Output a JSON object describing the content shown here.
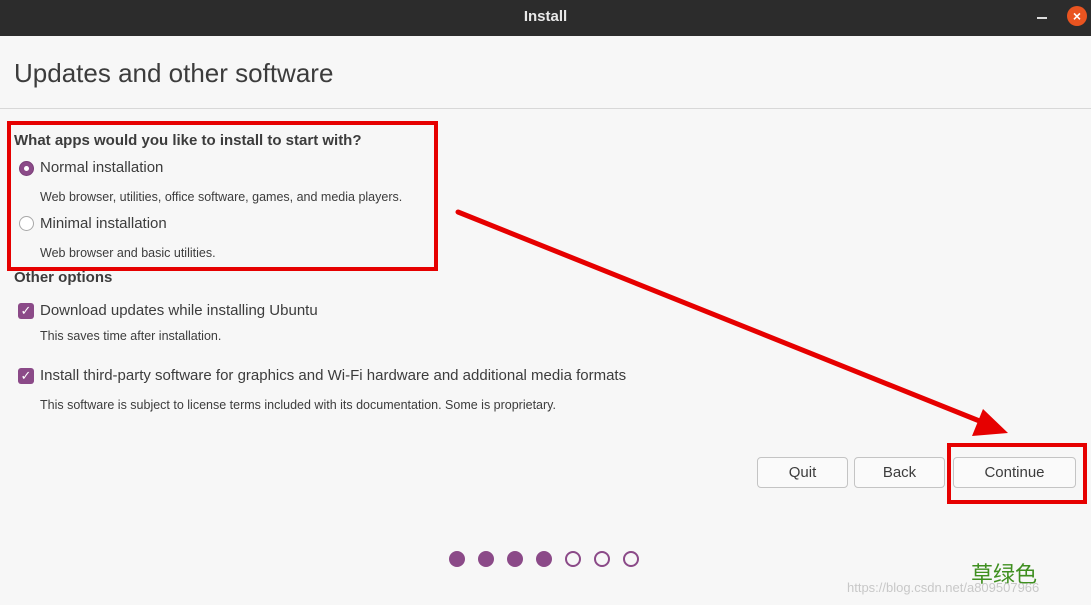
{
  "window": {
    "title": "Install",
    "minimize_icon": "minimize-icon",
    "close_icon": "close-icon",
    "close_color": "#e95420"
  },
  "page": {
    "title": "Updates and other software"
  },
  "apps_section": {
    "heading": "What apps would you like to install to start with?",
    "options": [
      {
        "label": "Normal installation",
        "description": "Web browser, utilities, office software, games, and media players.",
        "selected": true
      },
      {
        "label": "Minimal installation",
        "description": "Web browser and basic utilities.",
        "selected": false
      }
    ]
  },
  "other_options": {
    "heading": "Other options",
    "items": [
      {
        "label": "Download updates while installing Ubuntu",
        "description": "This saves time after installation.",
        "checked": true
      },
      {
        "label": "Install third-party software for graphics and Wi-Fi hardware and additional media formats",
        "description": "This software is subject to license terms included with its documentation. Some is proprietary.",
        "checked": true
      }
    ]
  },
  "buttons": {
    "quit": "Quit",
    "back": "Back",
    "continue": "Continue"
  },
  "progress": {
    "total_steps": 7,
    "completed_steps": 4
  },
  "watermark": {
    "cn_text": "草绿色",
    "url": "https://blog.csdn.net/a809507966"
  },
  "colors": {
    "accent": "#8b4a88",
    "annotation": "#e60000",
    "titlebar": "#2c2c2c"
  }
}
